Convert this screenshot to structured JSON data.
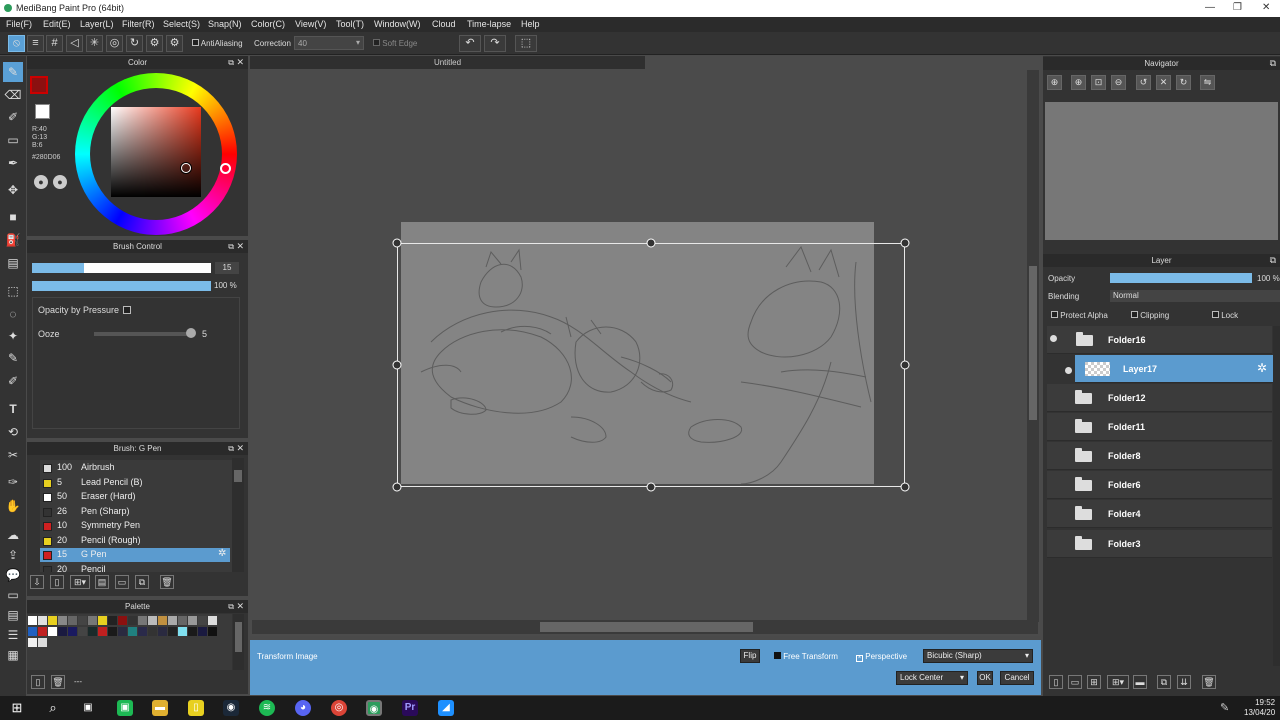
{
  "app": {
    "title": "MediBang Paint Pro (64bit)"
  },
  "menu": [
    "File(F)",
    "Edit(E)",
    "Layer(L)",
    "Filter(R)",
    "Select(S)",
    "Snap(N)",
    "Color(C)",
    "View(V)",
    "Tool(T)",
    "Window(W)",
    "Cloud",
    "Time-lapse",
    "Help"
  ],
  "toolbar": {
    "antialias_label": "AntiAliasing",
    "correction_label": "Correction",
    "correction_value": "40",
    "soft_edge_label": "Soft Edge"
  },
  "color_panel": {
    "title": "Color",
    "r": "R:40",
    "g": "G:13",
    "b": "B:6",
    "hex": "#280D06",
    "fg": "#8b1010",
    "bg": "#ffffff"
  },
  "brush_control": {
    "title": "Brush Control",
    "size": "15",
    "opacity": "100 %",
    "opacity_by_pressure": "Opacity by Pressure",
    "ooze_label": "Ooze",
    "ooze_value": "5"
  },
  "brush_list": {
    "title": "Brush: G Pen",
    "items": [
      {
        "size": "100",
        "name": "Airbrush",
        "color": "#dddddd"
      },
      {
        "size": "5",
        "name": "Lead Pencil (B)",
        "color": "#e8d020"
      },
      {
        "size": "50",
        "name": "Eraser (Hard)",
        "color": "#ffffff"
      },
      {
        "size": "26",
        "name": "Pen (Sharp)",
        "color": "#333333"
      },
      {
        "size": "10",
        "name": "Symmetry Pen",
        "color": "#d02020"
      },
      {
        "size": "20",
        "name": "Pencil (Rough)",
        "color": "#e8d020"
      },
      {
        "size": "15",
        "name": "G Pen",
        "color": "#d02020"
      },
      {
        "size": "20",
        "name": "Pencil",
        "color": "#333333"
      }
    ]
  },
  "palette": {
    "title": "Palette",
    "footer": "---"
  },
  "canvas": {
    "tab_title": "Untitled"
  },
  "transform": {
    "label": "Transform Image",
    "flip": "Flip",
    "free_transform": "Free Transform",
    "perspective": "Perspective",
    "interpolation": "Bicubic (Sharp)",
    "lock": "Lock Center",
    "ok": "OK",
    "cancel": "Cancel"
  },
  "navigator": {
    "title": "Navigator"
  },
  "layer_panel": {
    "title": "Layer",
    "opacity_label": "Opacity",
    "opacity_value": "100 %",
    "opacity_level": 1.0,
    "blending_label": "Blending",
    "blending_value": "Normal",
    "protect_alpha": "Protect Alpha",
    "clipping": "Clipping",
    "lock": "Lock",
    "layers": [
      {
        "name": "Folder16",
        "type": "folder"
      },
      {
        "name": "Layer17",
        "type": "layer",
        "selected": true
      },
      {
        "name": "Folder12",
        "type": "folder"
      },
      {
        "name": "Folder11",
        "type": "folder"
      },
      {
        "name": "Folder8",
        "type": "folder"
      },
      {
        "name": "Folder6",
        "type": "folder"
      },
      {
        "name": "Folder4",
        "type": "folder"
      },
      {
        "name": "Folder3",
        "type": "folder"
      }
    ]
  },
  "taskbar": {
    "time": "19:52",
    "date": "13/04/20"
  }
}
